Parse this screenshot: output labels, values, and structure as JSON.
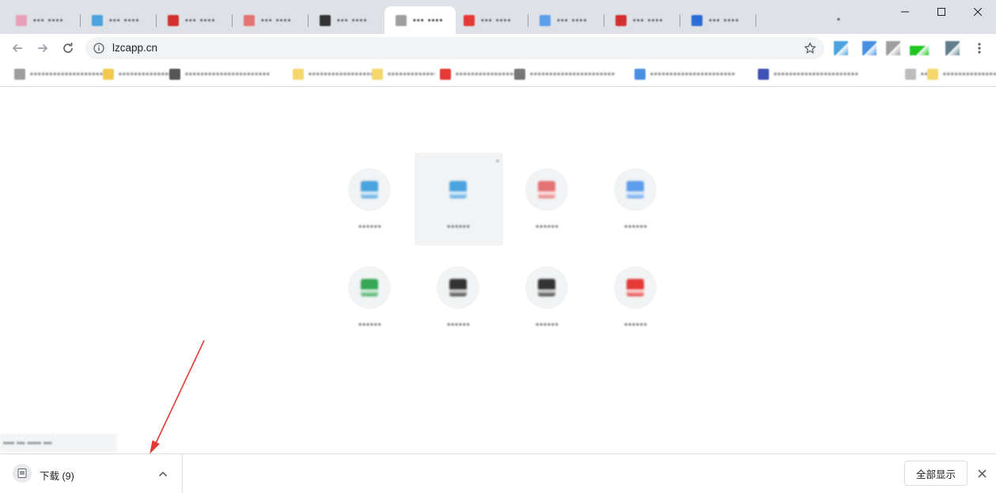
{
  "browser": {
    "address_bar": {
      "url": "lzcapp.cn"
    }
  },
  "tabs": [
    {
      "icon": "generic-site-icon",
      "color": "#e8a0b8"
    },
    {
      "icon": "generic-site-icon",
      "color": "#4aa3df"
    },
    {
      "icon": "generic-site-icon",
      "color": "#d32f2f"
    },
    {
      "icon": "generic-site-icon",
      "color": "#e57373"
    },
    {
      "icon": "generic-site-icon",
      "color": "#333333"
    },
    {
      "icon": "generic-site-icon",
      "color": "#9e9e9e"
    },
    {
      "icon": "generic-site-icon",
      "color": "#e53935"
    },
    {
      "icon": "generic-site-icon",
      "color": "#5c9ded"
    },
    {
      "icon": "generic-site-icon",
      "color": "#d32f2f"
    },
    {
      "icon": "generic-site-icon",
      "color": "#2b6cd8"
    }
  ],
  "extensions": [
    {
      "icon": "extension-icon",
      "color": "#4aa3df"
    },
    {
      "icon": "extension-icon",
      "color": "#4a90e2"
    },
    {
      "icon": "extension-icon",
      "color": "#9e9e9e"
    },
    {
      "icon": "extension-icon",
      "color": "#21c521"
    },
    {
      "icon": "extension-icon",
      "color": "#607d8b"
    }
  ],
  "bookmarks": [
    {
      "icon": "bookmark-favicon",
      "color": "#9e9e9e"
    },
    {
      "icon": "bookmark-favicon",
      "color": "#f2c94c"
    },
    {
      "icon": "bookmark-favicon",
      "color": "#555555"
    },
    {
      "icon": "folder-icon",
      "color": "#f5d76e"
    },
    {
      "icon": "folder-icon",
      "color": "#f5d76e"
    },
    {
      "icon": "bookmark-favicon",
      "color": "#e53935"
    },
    {
      "icon": "bookmark-favicon",
      "color": "#777777"
    },
    {
      "icon": "bookmark-favicon",
      "color": "#4a90e2"
    },
    {
      "icon": "bookmark-favicon",
      "color": "#3f51b5"
    },
    {
      "icon": "bookmark-favicon",
      "color": "#bdbdbd"
    },
    {
      "icon": "folder-icon",
      "color": "#f5d76e"
    }
  ],
  "shortcuts": [
    {
      "icon": "shortcut-favicon",
      "color": "#4aa3df"
    },
    {
      "icon": "shortcut-favicon",
      "color": "#4aa3df"
    },
    {
      "icon": "shortcut-favicon",
      "color": "#e57373"
    },
    {
      "icon": "shortcut-favicon",
      "color": "#5c9ded"
    },
    {
      "icon": "shortcut-favicon",
      "color": "#34a853"
    },
    {
      "icon": "shortcut-favicon",
      "color": "#333333"
    },
    {
      "icon": "shortcut-favicon",
      "color": "#333333"
    },
    {
      "icon": "shortcut-favicon",
      "color": "#e53935"
    }
  ],
  "download_shelf": {
    "item": {
      "name": "下载 (9)"
    },
    "show_all_label": "全部显示"
  }
}
